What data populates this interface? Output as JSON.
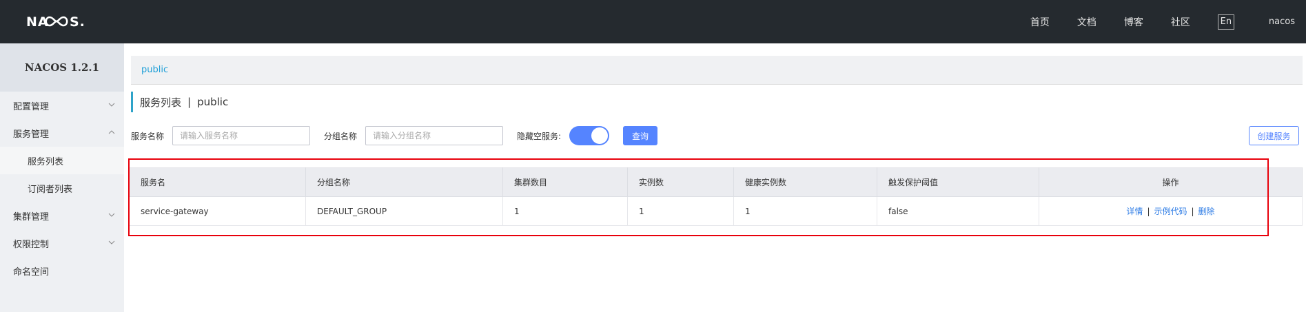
{
  "header": {
    "logo_text": "NACOS.",
    "nav": [
      "首页",
      "文档",
      "博客",
      "社区"
    ],
    "lang": "En",
    "user": "nacos"
  },
  "sidebar": {
    "title": "NACOS 1.2.1",
    "items": [
      {
        "label": "配置管理",
        "chevron": "down"
      },
      {
        "label": "服务管理",
        "chevron": "up"
      },
      {
        "label": "服务列表",
        "sub": true,
        "active": true
      },
      {
        "label": "订阅者列表",
        "sub": true
      },
      {
        "label": "集群管理",
        "chevron": "down"
      },
      {
        "label": "权限控制",
        "chevron": "down"
      },
      {
        "label": "命名空间"
      }
    ]
  },
  "main": {
    "namespace": "public",
    "title": "服务列表",
    "title_sep": "|",
    "title_ns": "public",
    "filters": {
      "service_label": "服务名称",
      "service_placeholder": "请输入服务名称",
      "group_label": "分组名称",
      "group_placeholder": "请输入分组名称",
      "hide_empty_label": "隐藏空服务:",
      "hide_empty_on": true,
      "query_button": "查询",
      "create_button": "创建服务"
    },
    "table": {
      "columns": [
        "服务名",
        "分组名称",
        "集群数目",
        "实例数",
        "健康实例数",
        "触发保护阈值",
        "操作"
      ],
      "rows": [
        {
          "service": "service-gateway",
          "group": "DEFAULT_GROUP",
          "clusters": "1",
          "instances": "1",
          "healthy": "1",
          "protect": "false"
        }
      ],
      "ops": [
        "详情",
        "示例代码",
        "删除"
      ],
      "op_sep": "|"
    }
  },
  "colors": {
    "topbar": "#252a2f",
    "accent": "#5584ff",
    "link": "#2c7be5",
    "highlight": "#e8000b"
  }
}
